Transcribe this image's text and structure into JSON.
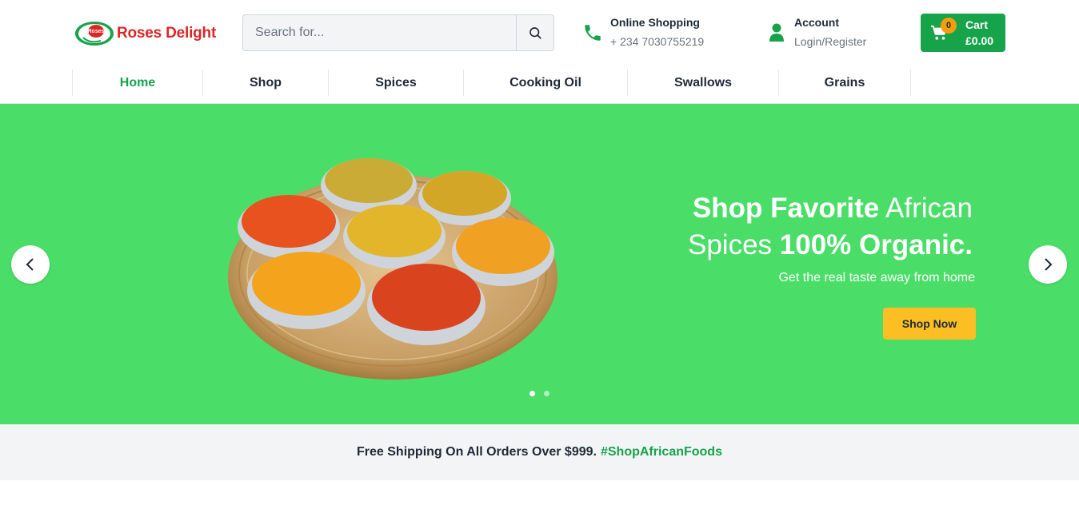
{
  "brand": {
    "name": "Roses Delight",
    "badge_text": "Roses",
    "color": "#dc2626",
    "ring_color": "#16a34a"
  },
  "search": {
    "placeholder": "Search for..."
  },
  "contact": {
    "title": "Online Shopping",
    "phone": "+ 234 7030755219"
  },
  "account": {
    "title": "Account",
    "link": "Login/Register"
  },
  "cart": {
    "count": "0",
    "label": "Cart",
    "total": "£0.00"
  },
  "nav": {
    "items": [
      {
        "label": "Home",
        "active": true
      },
      {
        "label": "Shop",
        "active": false
      },
      {
        "label": "Spices",
        "active": false
      },
      {
        "label": "Cooking Oil",
        "active": false
      },
      {
        "label": "Swallows",
        "active": false
      },
      {
        "label": "Grains",
        "active": false
      }
    ]
  },
  "hero": {
    "title_line1_bold": "Shop Favorite",
    "title_line1_regular": " African",
    "title_line2_regular": "Spices ",
    "title_line2_bold": "100% Organic.",
    "subtitle": "Get the real taste away from home",
    "cta": "Shop Now",
    "background": "#4ade68",
    "slides": 2,
    "active_slide": 1
  },
  "shipping": {
    "text": "Free Shipping On All Orders Over $999.",
    "hashtag": "#ShopAfricanFoods"
  },
  "colors": {
    "accent": "#16a34a",
    "cta": "#fbbf24"
  }
}
